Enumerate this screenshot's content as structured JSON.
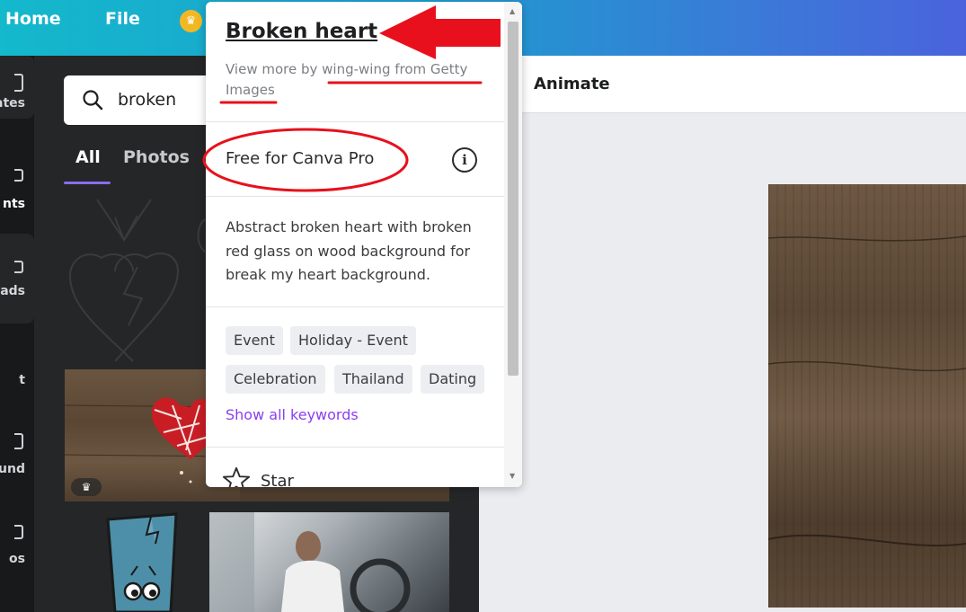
{
  "topbar": {
    "home_label": "Home",
    "file_label": "File",
    "crown_glyph": "♛"
  },
  "rail": {
    "items": [
      {
        "label": "ates",
        "icon": "templates-icon"
      },
      {
        "label": "nts",
        "icon": "elements-icon"
      },
      {
        "label": "ads",
        "icon": "uploads-icon"
      },
      {
        "label": "t",
        "icon": "text-icon"
      },
      {
        "label": "ound",
        "icon": "background-icon"
      },
      {
        "label": "os",
        "icon": "photos-icon"
      }
    ]
  },
  "panel": {
    "search_value": "broken",
    "tabs": [
      {
        "label": "All"
      },
      {
        "label": "Photos"
      }
    ],
    "crown_glyph": "♛"
  },
  "toolbar": {
    "animate_label": "Animate"
  },
  "popup": {
    "title": "Broken heart",
    "subtitle": "View more by wing-wing from Getty Images",
    "license": "Free for Canva Pro",
    "info_glyph": "i",
    "description": "Abstract broken heart with broken red glass on wood background for break my heart background.",
    "keywords": [
      "Event",
      "Holiday - Event",
      "Celebration",
      "Thailand",
      "Dating"
    ],
    "show_all": "Show all keywords",
    "star_label": "Star"
  },
  "colors": {
    "topbar_start": "#14b9cc",
    "topbar_end": "#4a63dd",
    "panel_bg": "#252627",
    "accent_purple": "#8b3ff0",
    "annotation_red": "#e8101c"
  }
}
